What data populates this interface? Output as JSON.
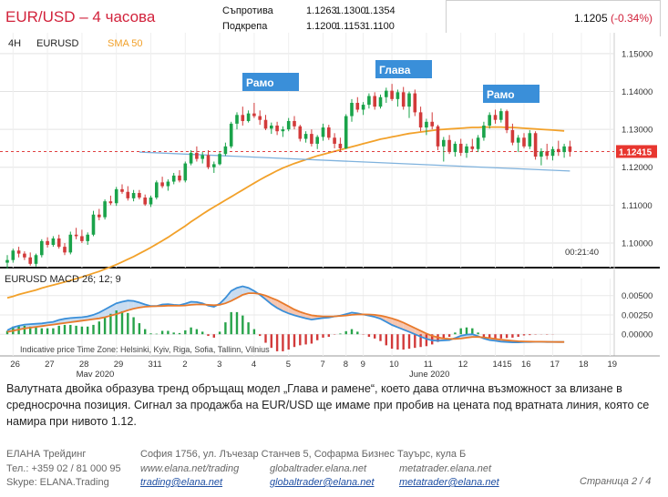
{
  "header": {
    "title": "EUR/USD – 4 часова",
    "resistance_label": "Съпротива",
    "resistance": [
      "1.1263",
      "1.1300",
      "1.1354"
    ],
    "support_label": "Подкрепа",
    "support": [
      "1.1200",
      "1.1153",
      "1.1100"
    ],
    "price": "1.1205",
    "change": "(-0.34%)"
  },
  "chart_data": {
    "type": "candlestick",
    "timeframe": "4H",
    "symbol": "EURUSD",
    "indicator_label": "SMA 50",
    "y_ticks": [
      "1.15000",
      "1.14000",
      "1.13000",
      "1.12000",
      "1.11000",
      "1.10000"
    ],
    "ylim": [
      1.0935,
      1.1555
    ],
    "current_price_label": "1.12415",
    "time_label": "00:21:40",
    "annotations": [
      "Рамо",
      "Глава",
      "Рамо"
    ],
    "candles": [
      [
        1.0948,
        1.0968,
        1.0932,
        1.0955
      ],
      [
        1.0955,
        1.0985,
        1.0948,
        1.098
      ],
      [
        1.098,
        1.099,
        1.0962,
        1.0972
      ],
      [
        1.0972,
        1.0978,
        1.0955,
        1.0962
      ],
      [
        1.0962,
        1.0975,
        1.094,
        1.0945
      ],
      [
        1.0945,
        1.0972,
        1.0938,
        1.0968
      ],
      [
        1.0968,
        1.101,
        1.0962,
        1.1005
      ],
      [
        1.1005,
        1.1015,
        1.0988,
        1.0995
      ],
      [
        1.0995,
        1.1018,
        1.099,
        1.1012
      ],
      [
        1.1012,
        1.1022,
        1.0985,
        1.099
      ],
      [
        1.099,
        1.1,
        1.0968,
        1.0975
      ],
      [
        1.0975,
        1.103,
        1.097,
        1.1022
      ],
      [
        1.1022,
        1.104,
        1.101,
        1.1018
      ],
      [
        1.1018,
        1.1035,
        1.1,
        1.1005
      ],
      [
        1.1005,
        1.1028,
        1.0995,
        1.1022
      ],
      [
        1.1022,
        1.1085,
        1.1018,
        1.1075
      ],
      [
        1.1075,
        1.109,
        1.106,
        1.1068
      ],
      [
        1.1068,
        1.1115,
        1.1062,
        1.111
      ],
      [
        1.111,
        1.1125,
        1.11,
        1.1105
      ],
      [
        1.1105,
        1.1148,
        1.1098,
        1.1142
      ],
      [
        1.1142,
        1.1155,
        1.113,
        1.1135
      ],
      [
        1.1135,
        1.115,
        1.1112,
        1.1118
      ],
      [
        1.1118,
        1.114,
        1.111,
        1.1132
      ],
      [
        1.1132,
        1.114,
        1.1115,
        1.112
      ],
      [
        1.112,
        1.1128,
        1.1098,
        1.1102
      ],
      [
        1.1102,
        1.1125,
        1.1095,
        1.112
      ],
      [
        1.112,
        1.1165,
        1.1115,
        1.116
      ],
      [
        1.116,
        1.1175,
        1.1145,
        1.115
      ],
      [
        1.115,
        1.1168,
        1.1138,
        1.1162
      ],
      [
        1.1162,
        1.1185,
        1.1155,
        1.1178
      ],
      [
        1.1178,
        1.1192,
        1.116,
        1.1165
      ],
      [
        1.1165,
        1.1215,
        1.116,
        1.121
      ],
      [
        1.121,
        1.1245,
        1.1205,
        1.1238
      ],
      [
        1.1238,
        1.1255,
        1.1215,
        1.1222
      ],
      [
        1.1222,
        1.124,
        1.121,
        1.1232
      ],
      [
        1.1232,
        1.1245,
        1.1195,
        1.12
      ],
      [
        1.12,
        1.1215,
        1.1185,
        1.1208
      ],
      [
        1.1208,
        1.124,
        1.1205,
        1.1235
      ],
      [
        1.1235,
        1.1265,
        1.123,
        1.1255
      ],
      [
        1.1255,
        1.132,
        1.125,
        1.1315
      ],
      [
        1.1315,
        1.1345,
        1.13,
        1.1338
      ],
      [
        1.1338,
        1.136,
        1.131,
        1.1322
      ],
      [
        1.1322,
        1.135,
        1.1318,
        1.1342
      ],
      [
        1.1342,
        1.137,
        1.133,
        1.1335
      ],
      [
        1.1335,
        1.135,
        1.1312,
        1.1325
      ],
      [
        1.1325,
        1.1338,
        1.1298,
        1.1302
      ],
      [
        1.1302,
        1.1318,
        1.1288,
        1.131
      ],
      [
        1.131,
        1.132,
        1.1285,
        1.1295
      ],
      [
        1.1295,
        1.1308,
        1.128,
        1.13
      ],
      [
        1.13,
        1.133,
        1.1295,
        1.1322
      ],
      [
        1.1322,
        1.1335,
        1.13,
        1.1308
      ],
      [
        1.1308,
        1.1312,
        1.1268,
        1.1275
      ],
      [
        1.1275,
        1.1295,
        1.1265,
        1.1288
      ],
      [
        1.1288,
        1.13,
        1.1255,
        1.1262
      ],
      [
        1.1262,
        1.1285,
        1.1248,
        1.128
      ],
      [
        1.128,
        1.1315,
        1.127,
        1.1305
      ],
      [
        1.1305,
        1.1312,
        1.1272,
        1.1278
      ],
      [
        1.1278,
        1.129,
        1.125,
        1.1262
      ],
      [
        1.1262,
        1.1278,
        1.124,
        1.125
      ],
      [
        1.125,
        1.134,
        1.1248,
        1.1335
      ],
      [
        1.1335,
        1.138,
        1.132,
        1.137
      ],
      [
        1.137,
        1.1385,
        1.1345,
        1.1352
      ],
      [
        1.1352,
        1.1372,
        1.1338,
        1.1365
      ],
      [
        1.1365,
        1.1395,
        1.1355,
        1.1388
      ],
      [
        1.1388,
        1.1398,
        1.1352,
        1.136
      ],
      [
        1.136,
        1.1392,
        1.1355,
        1.1385
      ],
      [
        1.1385,
        1.141,
        1.137,
        1.1402
      ],
      [
        1.1402,
        1.142,
        1.1375,
        1.138
      ],
      [
        1.138,
        1.1405,
        1.136,
        1.1398
      ],
      [
        1.1398,
        1.1412,
        1.1352,
        1.136
      ],
      [
        1.136,
        1.14,
        1.133,
        1.1395
      ],
      [
        1.1395,
        1.1405,
        1.1335,
        1.1345
      ],
      [
        1.1345,
        1.136,
        1.1295,
        1.1305
      ],
      [
        1.1305,
        1.1328,
        1.1285,
        1.132
      ],
      [
        1.132,
        1.1345,
        1.13,
        1.1308
      ],
      [
        1.1308,
        1.1312,
        1.1245,
        1.1255
      ],
      [
        1.1255,
        1.128,
        1.1215,
        1.1272
      ],
      [
        1.1272,
        1.1285,
        1.1235,
        1.124
      ],
      [
        1.124,
        1.1268,
        1.1228,
        1.1262
      ],
      [
        1.1262,
        1.1275,
        1.123,
        1.1238
      ],
      [
        1.1238,
        1.1262,
        1.1225,
        1.1255
      ],
      [
        1.1255,
        1.1275,
        1.1242,
        1.1248
      ],
      [
        1.1248,
        1.1285,
        1.124,
        1.1278
      ],
      [
        1.1278,
        1.132,
        1.127,
        1.131
      ],
      [
        1.131,
        1.1345,
        1.1302,
        1.1338
      ],
      [
        1.1338,
        1.1352,
        1.1315,
        1.1325
      ],
      [
        1.1325,
        1.1355,
        1.1318,
        1.1348
      ],
      [
        1.1348,
        1.1352,
        1.129,
        1.1298
      ],
      [
        1.1298,
        1.1315,
        1.1258,
        1.1265
      ],
      [
        1.1265,
        1.1285,
        1.124,
        1.1278
      ],
      [
        1.1278,
        1.129,
        1.125,
        1.1255
      ],
      [
        1.1255,
        1.1298,
        1.1248,
        1.129
      ],
      [
        1.129,
        1.1295,
        1.122,
        1.1228
      ],
      [
        1.1228,
        1.125,
        1.1205,
        1.1242
      ],
      [
        1.1242,
        1.1262,
        1.122,
        1.123
      ],
      [
        1.123,
        1.1255,
        1.1218,
        1.1248
      ],
      [
        1.1248,
        1.127,
        1.123,
        1.124
      ],
      [
        1.124,
        1.1262,
        1.1225,
        1.1255
      ],
      [
        1.1255,
        1.127,
        1.1228,
        1.1242
      ]
    ],
    "sma50": [
      1.0855,
      1.0859,
      1.0864,
      1.0868,
      1.0872,
      1.0876,
      1.0881,
      1.0885,
      1.0889,
      1.0893,
      1.0897,
      1.0901,
      1.0906,
      1.091,
      1.0915,
      1.092,
      1.0925,
      1.0931,
      1.0937,
      1.0943,
      1.095,
      1.0957,
      1.0964,
      1.0972,
      1.098,
      1.0988,
      1.0997,
      1.1006,
      1.1015,
      1.1025,
      1.1035,
      1.1045,
      1.1056,
      1.1066,
      1.1076,
      1.1086,
      1.1095,
      1.1104,
      1.1113,
      1.1122,
      1.1131,
      1.114,
      1.1149,
      1.1158,
      1.1167,
      1.1175,
      1.1183,
      1.1191,
      1.1198,
      1.1204,
      1.121,
      1.1215,
      1.122,
      1.1225,
      1.123,
      1.1234,
      1.1238,
      1.1242,
      1.1246,
      1.125,
      1.1254,
      1.1258,
      1.1262,
      1.1266,
      1.127,
      1.1274,
      1.1277,
      1.128,
      1.1283,
      1.1286,
      1.1289,
      1.1291,
      1.1293,
      1.1295,
      1.1297,
      1.1299,
      1.13,
      1.1301,
      1.1302,
      1.1303,
      1.1304,
      1.1305,
      1.1305,
      1.1306,
      1.1306,
      1.1306,
      1.1306,
      1.1305,
      1.1305,
      1.1304,
      1.1303,
      1.1302,
      1.1301,
      1.13,
      1.1299,
      1.1298,
      1.1297,
      1.1296
    ],
    "neckline": [
      [
        23,
        1.124
      ],
      [
        98,
        1.119
      ]
    ],
    "macd": {
      "label": "EURUSD  MACD 26; 12; 9",
      "y_ticks": [
        "0.00500",
        "0.00250",
        "0.00000"
      ],
      "ylim": [
        -0.0028,
        0.0072
      ],
      "macd_line": [
        0.0005,
        0.0009,
        0.0011,
        0.00125,
        0.0013,
        0.00135,
        0.0014,
        0.0015,
        0.0016,
        0.00185,
        0.002,
        0.0021,
        0.00215,
        0.0022,
        0.0023,
        0.0025,
        0.0028,
        0.0032,
        0.0036,
        0.004,
        0.0042,
        0.00435,
        0.0043,
        0.0041,
        0.00385,
        0.00365,
        0.00365,
        0.00385,
        0.0039,
        0.0038,
        0.00375,
        0.00395,
        0.0042,
        0.00415,
        0.004,
        0.0037,
        0.00355,
        0.00395,
        0.0047,
        0.0056,
        0.006,
        0.0062,
        0.006,
        0.0056,
        0.0051,
        0.0045,
        0.0039,
        0.0034,
        0.003,
        0.0027,
        0.00245,
        0.00225,
        0.00205,
        0.0019,
        0.002,
        0.0021,
        0.00215,
        0.0023,
        0.0024,
        0.0026,
        0.0028,
        0.0027,
        0.00255,
        0.0024,
        0.00225,
        0.002,
        0.0016,
        0.0012,
        0.0009,
        0.0006,
        0.0003,
        0.0,
        -0.0003,
        -0.0006,
        -0.0008,
        -0.00085,
        -0.0008,
        -0.00075,
        -0.0005,
        -0.0002,
        -5e-05,
        0.0,
        -0.00025,
        -0.00055,
        -0.00075,
        -0.00085,
        -0.00095,
        -0.001,
        -0.00105,
        -0.00105,
        -0.001,
        -0.001,
        -0.00098,
        -0.00098,
        -0.001,
        -0.001,
        -0.001,
        -0.001
      ],
      "signal_line": [
        0.0003,
        0.00045,
        0.0006,
        0.00075,
        0.00085,
        0.00095,
        0.00105,
        0.00115,
        0.00125,
        0.00135,
        0.00145,
        0.00155,
        0.00165,
        0.00175,
        0.00185,
        0.00195,
        0.00205,
        0.0022,
        0.0024,
        0.0026,
        0.00285,
        0.0031,
        0.0033,
        0.00345,
        0.00355,
        0.0036,
        0.00362,
        0.00365,
        0.0037,
        0.0037,
        0.00368,
        0.00372,
        0.0038,
        0.00385,
        0.00385,
        0.0038,
        0.00375,
        0.0038,
        0.004,
        0.0043,
        0.0047,
        0.0051,
        0.0053,
        0.0053,
        0.0052,
        0.005,
        0.0047,
        0.0044,
        0.004,
        0.0036,
        0.0032,
        0.0029,
        0.00265,
        0.00245,
        0.00235,
        0.0023,
        0.0023,
        0.00232,
        0.00236,
        0.00242,
        0.0025,
        0.00255,
        0.00257,
        0.00255,
        0.0025,
        0.0024,
        0.00225,
        0.00205,
        0.0018,
        0.0015,
        0.00115,
        0.0008,
        0.00045,
        0.0001,
        -0.0002,
        -0.0004,
        -0.00055,
        -0.0006,
        -0.0006,
        -0.00055,
        -0.00045,
        -0.00035,
        -0.00035,
        -0.0004,
        -0.0005,
        -0.0006,
        -0.0007,
        -0.00078,
        -0.00085,
        -0.0009,
        -0.00093,
        -0.00095,
        -0.00096,
        -0.00097,
        -0.00098,
        -0.00099,
        -0.001,
        -0.001
      ]
    },
    "info_line": "Indicative price   Time Zone: Helsinki, Kyiv, Riga, Sofia, Tallinn, Vilnius",
    "x_axis": {
      "day_labels": [
        "26",
        "27",
        "28",
        "29",
        "311",
        "2",
        "3",
        "4",
        "5",
        "7",
        "8",
        "9",
        "10",
        "11",
        "12",
        "1415",
        "16",
        "17",
        "18",
        "19"
      ],
      "day_index": [
        1,
        7,
        13,
        19,
        25,
        31,
        37,
        43,
        49,
        55,
        59,
        62,
        67,
        73,
        79,
        85,
        90,
        95,
        100,
        105
      ],
      "month_labels": [
        "May 2020",
        "June 2020"
      ],
      "month_index": [
        12,
        70
      ]
    }
  },
  "caption": "Валутната двойка образува тренд обръщащ модел „Глава и рамене“, което дава отлична възможност за влизане в средносрочна позиция. Сигнал за продажба на EUR/USD ще имаме при пробив на цената под вратната линия, която се намира при нивото 1.12.",
  "footer": {
    "company": "ЕЛАНА Трейдинг",
    "phone": "Тел.: +359 02 / 81 000 95",
    "skype": "Skype: ELANA.Trading",
    "address": "София 1756, ул. Лъчезар Станчев 5, Софарма Бизнес Тауърс, кула Б",
    "links": [
      "www.elana.net/trading",
      "trading@elana.net",
      "globaltrader.elana.net",
      "globaltrader@elana.net",
      "metatrader.elana.net",
      "metatrader@elana.net"
    ],
    "page": "Страница  2 / 4"
  }
}
